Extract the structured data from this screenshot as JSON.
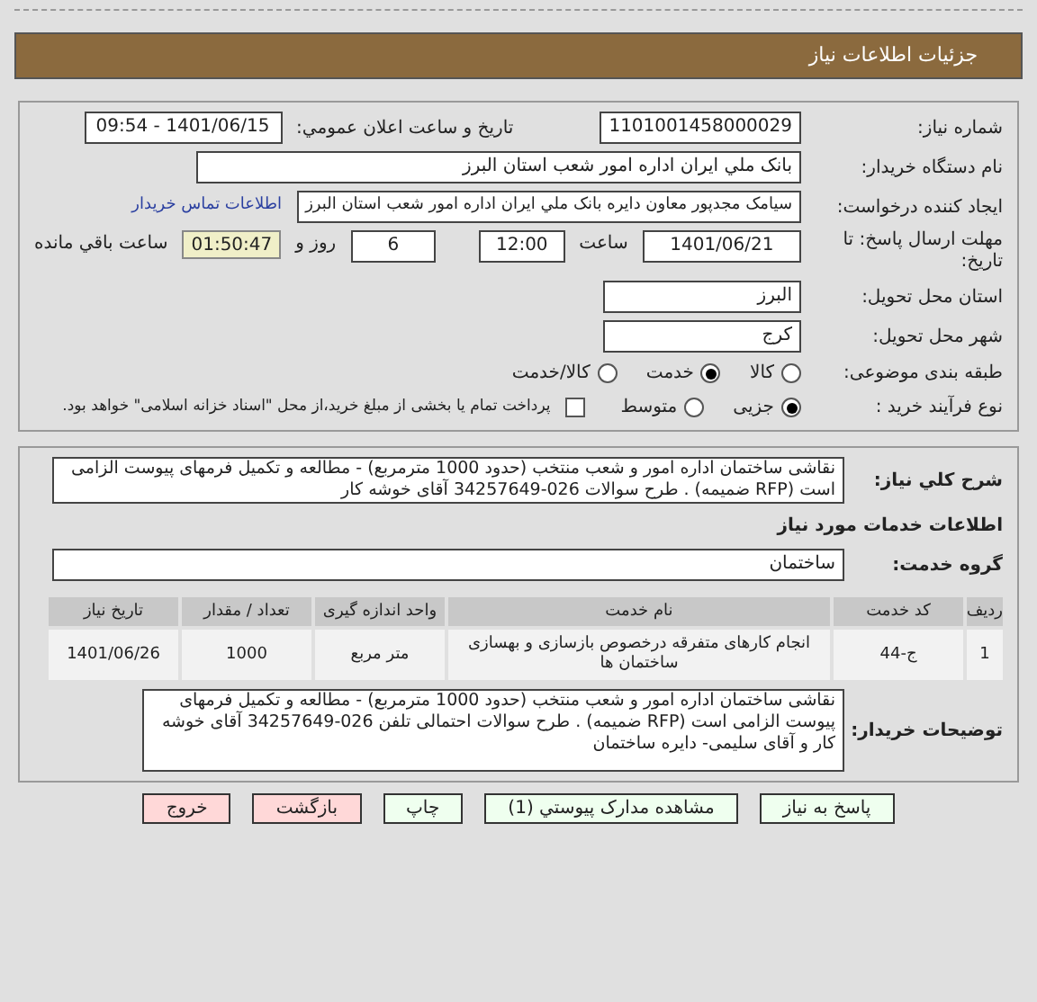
{
  "header": {
    "title": "جزئیات اطلاعات نیاز"
  },
  "need_number": {
    "label": "شماره نیاز:",
    "value": "1101001458000029"
  },
  "announce": {
    "label": "تاریخ و ساعت اعلان عمومي:",
    "value": "1401/06/15 - 09:54"
  },
  "buyer": {
    "label": "نام دستگاه خریدار:",
    "value": "بانک ملي ايران اداره امور شعب استان البرز"
  },
  "creator": {
    "label": "ایجاد کننده درخواست:",
    "value": "سیامک مجدپور معاون دایره  بانک ملي ايران اداره امور شعب استان البرز",
    "link": "اطلاعات تماس خریدار"
  },
  "deadline": {
    "label": "مهلت ارسال پاسخ: تا تاریخ:",
    "date": "1401/06/21",
    "time_label": "ساعت",
    "time": "12:00",
    "days": "6",
    "days_label": "روز و",
    "remaining": "01:50:47",
    "remaining_label": "ساعت باقي مانده"
  },
  "province": {
    "label": "استان محل تحویل:",
    "value": "البرز"
  },
  "city": {
    "label": "شهر محل تحویل:",
    "value": "کرج"
  },
  "category": {
    "label": "طبقه بندی موضوعی:",
    "options": [
      {
        "label": "کالا",
        "selected": false
      },
      {
        "label": "خدمت",
        "selected": true
      },
      {
        "label": "کالا/خدمت",
        "selected": false
      }
    ]
  },
  "process": {
    "label": "نوع فرآیند خرید :",
    "options": [
      {
        "label": "جزیی",
        "selected": true
      },
      {
        "label": "متوسط",
        "selected": false
      }
    ],
    "treasury": {
      "label": "پرداخت تمام یا بخشی از مبلغ خرید،از محل \"اسناد خزانه اسلامی\" خواهد بود.",
      "checked": false
    }
  },
  "description": {
    "label": "شرح کلي نیاز:",
    "value": "نقاشی ساختمان اداره امور و شعب منتخب (حدود 1000 مترمربع) - مطالعه و تکمیل فرمهای پیوست الزامی است (RFP ضمیمه) . طرح سوالات 026-34257649 آقای خوشه کار"
  },
  "services_heading": "اطلاعات خدمات مورد نیاز",
  "service_group": {
    "label": "گروه خدمت:",
    "value": "ساختمان"
  },
  "table": {
    "columns": [
      "ردیف",
      "کد خدمت",
      "نام خدمت",
      "واحد اندازه گیری",
      "تعداد / مقدار",
      "تاریخ نیاز"
    ],
    "rows": [
      [
        "1",
        "ج-44",
        "انجام کارهای متفرقه درخصوص بازسازی و بهسازی ساختمان ها",
        "متر مربع",
        "1000",
        "1401/06/26"
      ]
    ]
  },
  "buyer_notes": {
    "label": "توضیحات خریدار:",
    "value": "نقاشی ساختمان اداره امور و شعب منتخب (حدود 1000 مترمربع) - مطالعه و تکمیل فرمهای پیوست الزامی است (RFP ضمیمه) . طرح سوالات احتمالی تلفن 026-34257649 آقای خوشه کار و آقای سلیمی- دایره ساختمان"
  },
  "buttons": [
    {
      "label": "پاسخ به نیاز",
      "kind": "go"
    },
    {
      "label": "مشاهده مدارک پیوستي (1)",
      "kind": "go"
    },
    {
      "label": "چاپ",
      "kind": "go"
    },
    {
      "label": "بازگشت",
      "kind": "leave"
    },
    {
      "label": "خروج",
      "kind": "leave"
    }
  ]
}
